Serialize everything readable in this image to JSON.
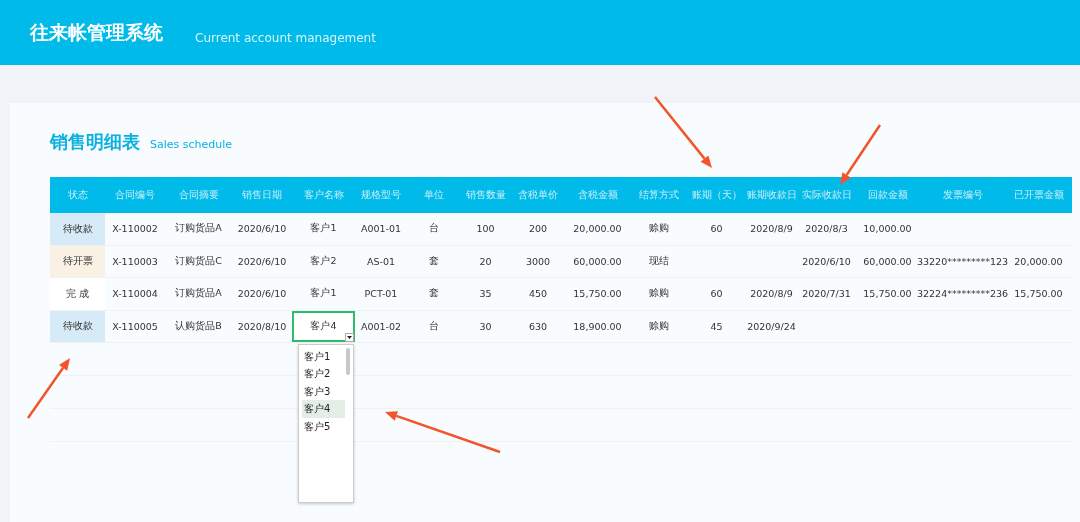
{
  "header": {
    "title": "往来帐管理系统",
    "subtitle": "Current account management"
  },
  "panel": {
    "title": "销售明细表",
    "subtitle": "Sales schedule"
  },
  "table": {
    "columns": [
      "状态",
      "合同编号",
      "合同摘要",
      "销售日期",
      "客户名称",
      "规格型号",
      "单位",
      "销售数量",
      "含税单价",
      "含税金额",
      "结算方式",
      "账期（天）",
      "账期收款日",
      "实际收款日",
      "回款金额",
      "发票编号",
      "已开票金额"
    ],
    "rows": [
      {
        "color": "#d6ebf7",
        "editing": false,
        "cells": [
          "待收款",
          "X-110002",
          "订购货品A",
          "2020/6/10",
          "客户1",
          "A001-01",
          "台",
          "100",
          "200",
          "20,000.00",
          "赊购",
          "60",
          "2020/8/9",
          "2020/8/3",
          "10,000.00",
          "",
          ""
        ]
      },
      {
        "color": "#f8f1e4",
        "editing": false,
        "cells": [
          "待开票",
          "X-110003",
          "订购货品C",
          "2020/6/10",
          "客户2",
          "AS-01",
          "套",
          "20",
          "3000",
          "60,000.00",
          "现结",
          "",
          "",
          "2020/6/10",
          "60,000.00",
          "33220*********123",
          "20,000.00"
        ]
      },
      {
        "color": "#ffffff",
        "editing": false,
        "cells": [
          "完 成",
          "X-110004",
          "订购货品A",
          "2020/6/10",
          "客户1",
          "PCT-01",
          "套",
          "35",
          "450",
          "15,750.00",
          "赊购",
          "60",
          "2020/8/9",
          "2020/7/31",
          "15,750.00",
          "32224*********236",
          "15,750.00"
        ]
      },
      {
        "color": "#d6ebf7",
        "editing": true,
        "cells": [
          "待收款",
          "X-110005",
          "认购货品B",
          "2020/8/10",
          "客户4",
          "A001-02",
          "台",
          "30",
          "630",
          "18,900.00",
          "赊购",
          "45",
          "2020/9/24",
          "",
          "",
          "",
          ""
        ]
      }
    ]
  },
  "dropdown": {
    "options": [
      {
        "label": "客户1",
        "selected": false
      },
      {
        "label": "客户2",
        "selected": false
      },
      {
        "label": "客户3",
        "selected": false
      },
      {
        "label": "客户4",
        "selected": true
      },
      {
        "label": "客户5",
        "selected": false
      }
    ]
  }
}
